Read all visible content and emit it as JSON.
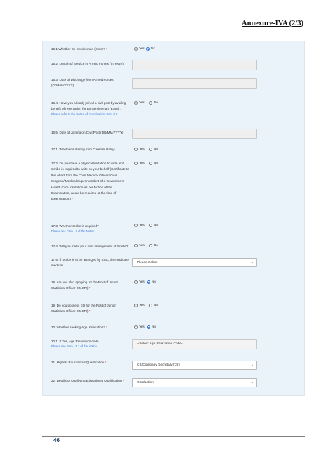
{
  "header": {
    "annexure": "Annexure-IVA (2/3)"
  },
  "fields": {
    "q16_1": {
      "label": "16.1 Whether Ex-Serviceman (ESM)?",
      "star": "*",
      "opt1": "Yes",
      "opt2": "No"
    },
    "q16_2": {
      "label": "16.2. Length of Service in Armed Forces (In Years)"
    },
    "q16_3": {
      "label1": "16.3. Date of Discharge from Armed Forces",
      "label2": "(DD/MM/YYYY)"
    },
    "q16_4": {
      "label1": "16.4. Have you already joined a civil post by availing",
      "label2": "benefit of reservation for Ex-Serviceman (ESM) .",
      "note": "Please refer to the Notice of Examination, Para 6.6",
      "opt1": "Yes",
      "opt2": "No"
    },
    "q16_5": {
      "label": "16.5. Date of Joining on Civil Post (DD/MM/YYYY)"
    },
    "q17_1": {
      "label": "17.1. Whether suffering from Cerebral Palsy",
      "opt1": "Yes",
      "opt2": "No"
    },
    "q17_2": {
      "lines": [
        "17.2. Do you have a physical limitation to write and",
        "Scribe is required to write on your behalf (Certificate to",
        "this effect from the Chief Medical Officer/ Civil",
        "Surgeon/ Medical Superintendent of a Government",
        "Health Care Institution as per Notice of the",
        "Examination, would be required at the time of",
        "Examination.)?"
      ],
      "opt1": "Yes",
      "opt2": "No"
    },
    "q17_3": {
      "label": "17.3. Whether scribe is required?",
      "note": "Please see Para - 7 of the Notice",
      "opt1": "Yes",
      "opt2": "No"
    },
    "q17_4": {
      "label": "17.4. Will you make your own arrangement of Scribe?",
      "opt1": "Yes",
      "opt2": "No"
    },
    "q17_5": {
      "label1": "17.5. If Scribe is to be arranged by SSC, then Indicate",
      "label2": "medium",
      "value": "Please Select"
    },
    "q18": {
      "label1": "18. Are you also applying for the Post of Junior",
      "label2": "Statistical Officer (MoSPI)",
      "star": "*",
      "opt1": "Yes",
      "opt2": "No"
    },
    "q19": {
      "label1": "19. Do you possess EQ for the Post of Junior",
      "label2": "Statistical Officer (MoSPI)",
      "star": "*",
      "opt1": "Yes",
      "opt2": "No"
    },
    "q20": {
      "label": "20. Whether seeking Age Relaxation?",
      "star": "*",
      "opt1": "Yes",
      "opt2": "No"
    },
    "q20_1": {
      "label": "20.1. If Yes, Age Relaxation code.",
      "note": "Please see Para - 5.2 of the Notice",
      "value": "--Select Age Relaxation Code--"
    },
    "q21": {
      "label": "21. Highest Educational Qualification",
      "star": "*",
      "value": "CS(Company Secretary)(39)"
    },
    "q22": {
      "label": "22. Details of Qualifying Educational Qualification",
      "star": "*",
      "value": "Graduation"
    }
  },
  "footer": {
    "page_number": "46"
  }
}
